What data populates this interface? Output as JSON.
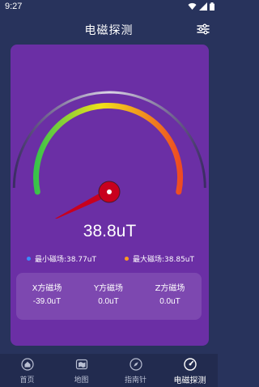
{
  "status_bar": {
    "time": "9:27"
  },
  "header": {
    "title": "电磁探测"
  },
  "gauge": {
    "fraction": 0.03,
    "reading": "38.8uT"
  },
  "legend": {
    "min_text": "最小磁场:38.77uT",
    "max_text": "最大磁场:38.85uT",
    "min_color": "#3a8cff",
    "max_color": "#ff9a1f"
  },
  "axes": [
    {
      "label": "X方磁场",
      "value": "-39.0uT"
    },
    {
      "label": "Y方磁场",
      "value": "0.0uT"
    },
    {
      "label": "Z方磁场",
      "value": "0.0uT"
    }
  ],
  "nav": [
    {
      "label": "首页",
      "icon": "home-icon"
    },
    {
      "label": "地图",
      "icon": "map-icon"
    },
    {
      "label": "指南针",
      "icon": "compass-icon"
    },
    {
      "label": "电磁探测",
      "icon": "gauge-icon"
    }
  ],
  "colors": {
    "background": "#28335c",
    "card": "#6b2fa5",
    "needle": "#c8001e",
    "arc_start": "#38c34a",
    "arc_mid": "#f2e21a",
    "arc_end": "#ee4b22"
  }
}
